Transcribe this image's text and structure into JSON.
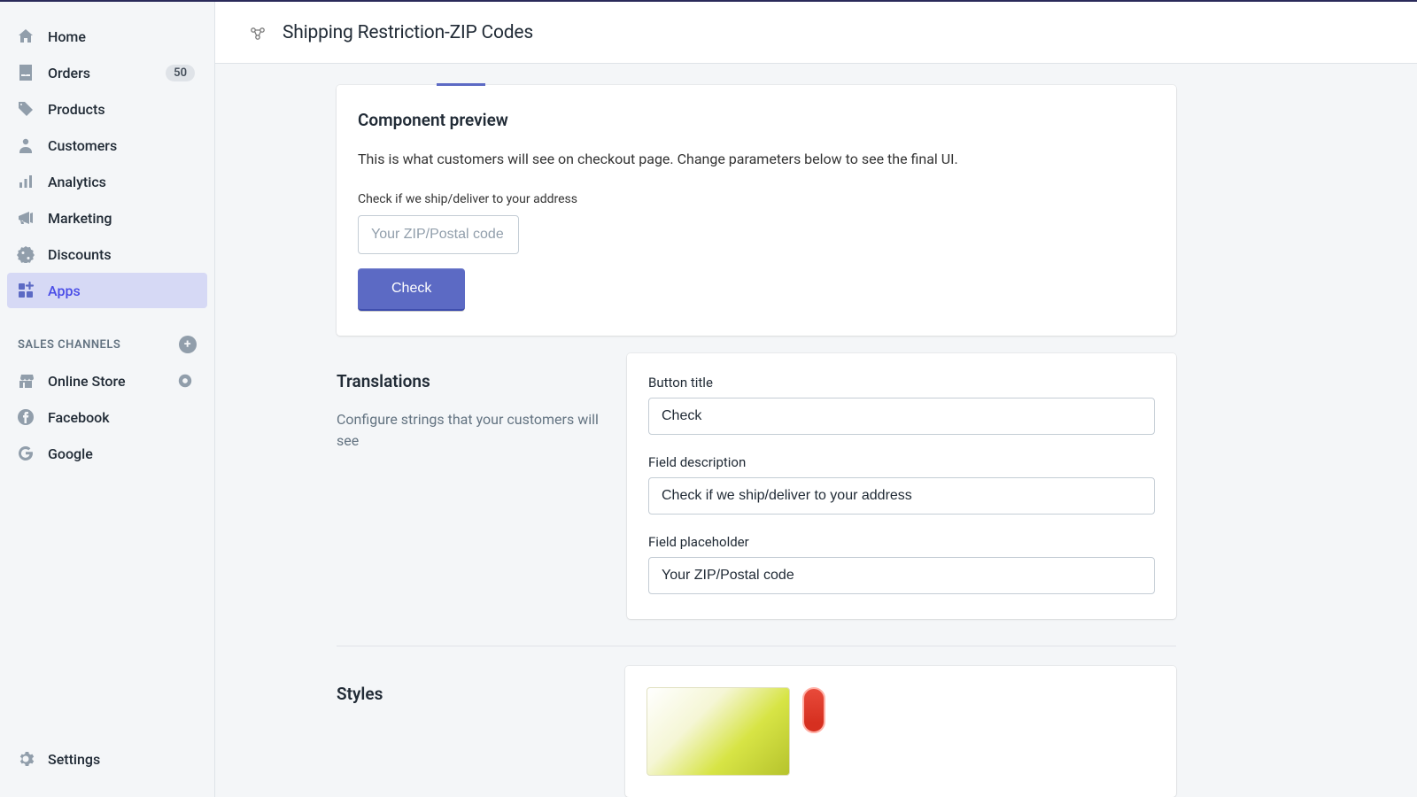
{
  "sidebar": {
    "items": [
      {
        "label": "Home"
      },
      {
        "label": "Orders",
        "badge": "50"
      },
      {
        "label": "Products"
      },
      {
        "label": "Customers"
      },
      {
        "label": "Analytics"
      },
      {
        "label": "Marketing"
      },
      {
        "label": "Discounts"
      },
      {
        "label": "Apps"
      }
    ],
    "salesChannelsHeading": "SALES CHANNELS",
    "channels": [
      {
        "label": "Online Store"
      },
      {
        "label": "Facebook"
      },
      {
        "label": "Google"
      }
    ],
    "settingsLabel": "Settings"
  },
  "header": {
    "title": "Shipping Restriction-ZIP Codes"
  },
  "previewCard": {
    "title": "Component preview",
    "description": "This is what customers will see on checkout page. Change parameters below to see the final UI.",
    "fieldLabel": "Check if we ship/deliver to your address",
    "placeholder": "Your ZIP/Postal code",
    "buttonLabel": "Check"
  },
  "translations": {
    "heading": "Translations",
    "subtext": "Configure strings that your customers will see",
    "fields": {
      "buttonTitleLabel": "Button title",
      "buttonTitleValue": "Check",
      "fieldDescLabel": "Field description",
      "fieldDescValue": "Check if we ship/deliver to your address",
      "fieldPlaceholderLabel": "Field placeholder",
      "fieldPlaceholderValue": "Your ZIP/Postal code"
    }
  },
  "styles": {
    "heading": "Styles"
  }
}
